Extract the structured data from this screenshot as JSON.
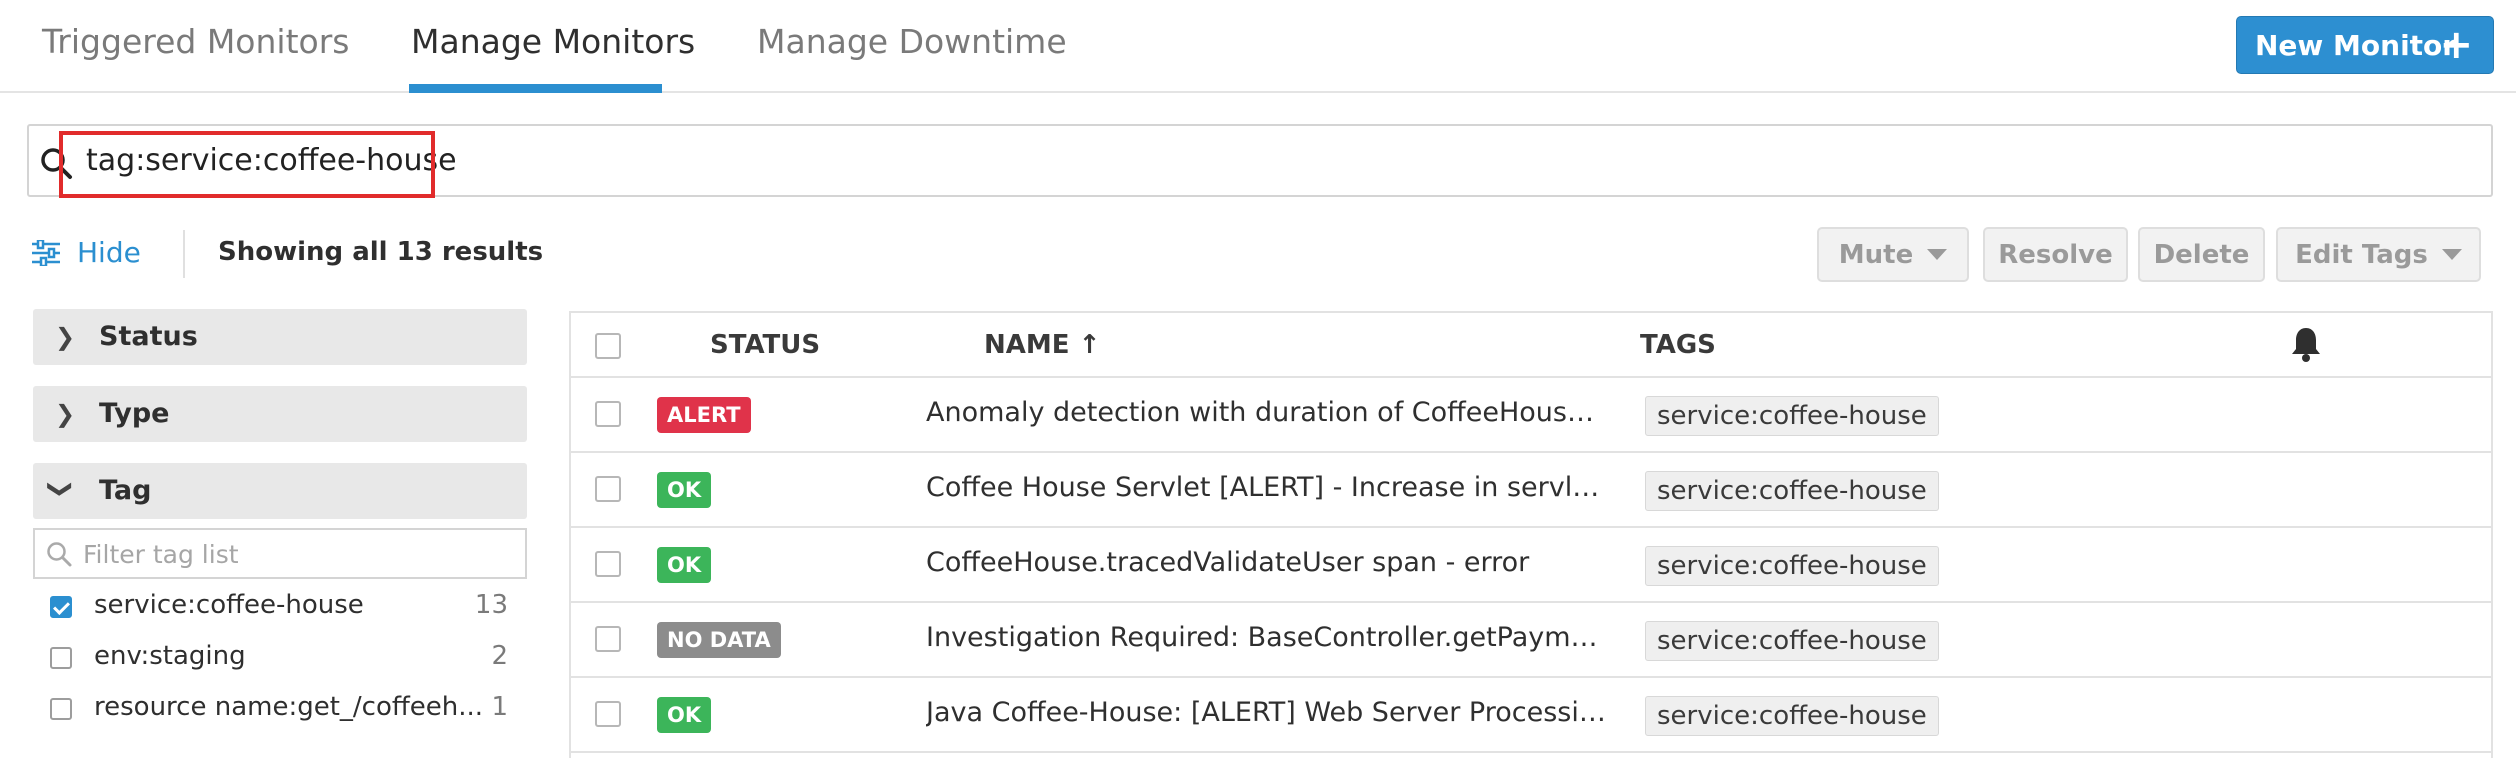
{
  "tabs": [
    {
      "label": "Triggered Monitors",
      "active": false
    },
    {
      "label": "Manage Monitors",
      "active": true
    },
    {
      "label": "Manage Downtime",
      "active": false
    }
  ],
  "new_monitor": {
    "label": "New Monitor",
    "icon": "plus-icon"
  },
  "search": {
    "query": "tag:service:coffee-house",
    "icon": "search-icon"
  },
  "filters_toggle": {
    "label": "Hide",
    "icon": "sliders-icon"
  },
  "results_text": "Showing all 13 results",
  "bulk_actions": {
    "mute": "Mute",
    "resolve": "Resolve",
    "delete": "Delete",
    "edit_tags": "Edit Tags"
  },
  "facets": {
    "status": {
      "label": "Status",
      "expanded": false
    },
    "type": {
      "label": "Type",
      "expanded": false
    },
    "tag": {
      "label": "Tag",
      "expanded": true,
      "filter_placeholder": "Filter tag list",
      "items": [
        {
          "name": "service:coffee-house",
          "count": "13",
          "checked": true
        },
        {
          "name": "env:staging",
          "count": "2",
          "checked": false
        },
        {
          "name": "resource name:get_/coffeeh...",
          "count": "1",
          "checked": false
        }
      ]
    }
  },
  "table": {
    "columns": {
      "status": "STATUS",
      "name": "NAME ↑",
      "tags": "TAGS",
      "notify_icon": "bell-icon"
    },
    "rows": [
      {
        "status": "ALERT",
        "name": "Anomaly detection with duration of CoffeeHouse.trac...",
        "tag": "service:coffee-house"
      },
      {
        "status": "OK",
        "name": "Coffee House Servlet [ALERT] - Increase in servlet proc...",
        "tag": "service:coffee-house"
      },
      {
        "status": "OK",
        "name": "CoffeeHouse.tracedValidateUser span - error",
        "tag": "service:coffee-house"
      },
      {
        "status": "NO DATA",
        "name": "Investigation Required: BaseController.getPayment() ...",
        "tag": "service:coffee-house"
      },
      {
        "status": "OK",
        "name": "Java Coffee-House: [ALERT] Web Server Processing Ti...",
        "tag": "service:coffee-house"
      }
    ]
  },
  "colors": {
    "accent": "#2b8fd0",
    "alert": "#e0334a",
    "ok": "#3cb55a",
    "no_data": "#8c8c8c",
    "highlight": "#e12b2b"
  }
}
